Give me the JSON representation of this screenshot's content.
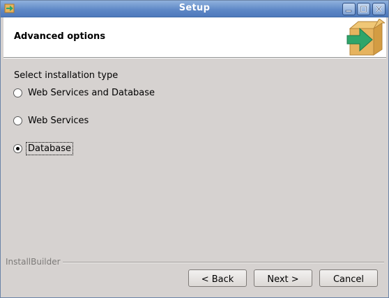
{
  "window": {
    "title": "Setup",
    "controls": [
      "minimize-icon",
      "maximize-icon",
      "close-icon"
    ]
  },
  "header": {
    "title": "Advanced options"
  },
  "installation": {
    "label": "Select installation type",
    "options": [
      {
        "label": "Web Services and Database",
        "selected": false
      },
      {
        "label": "Web Services",
        "selected": false
      },
      {
        "label": "Database",
        "selected": true
      }
    ]
  },
  "footer": {
    "brand": "InstallBuilder",
    "back_label": "< Back",
    "next_label": "Next >",
    "cancel_label": "Cancel"
  },
  "colors": {
    "titlebar": "#5c86c5",
    "logo_box": "#e5b25c",
    "logo_arrow": "#2fa56a"
  }
}
